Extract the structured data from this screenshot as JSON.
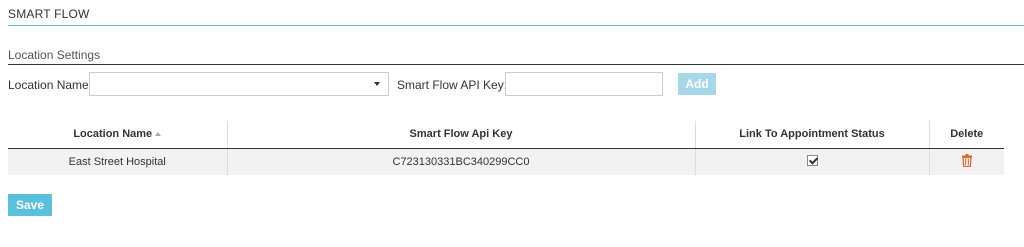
{
  "header": {
    "title": "SMART FLOW"
  },
  "location_settings": {
    "section_title": "Location Settings",
    "location_name_label": "Location Name",
    "location_name_value": "",
    "api_key_label": "Smart Flow API Key:",
    "api_key_value": "",
    "add_label": "Add"
  },
  "table": {
    "columns": [
      "Location Name",
      "Smart Flow Api Key",
      "Link To Appointment Status",
      "Delete"
    ],
    "rows": [
      {
        "location_name": "East Street Hospital",
        "api_key": "C723130331BC340299CC0",
        "linked": true
      }
    ]
  },
  "save_label": "Save",
  "colors": {
    "accent": "#5bc0de",
    "add_disabled": "#a7d8ea",
    "delete": "#e8632b"
  }
}
